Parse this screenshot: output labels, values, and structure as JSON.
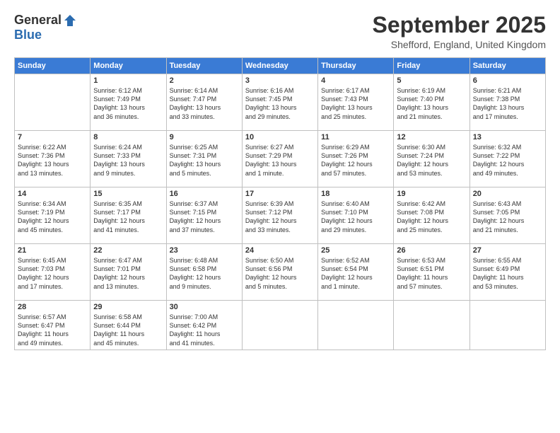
{
  "logo": {
    "general": "General",
    "blue": "Blue"
  },
  "title": "September 2025",
  "location": "Shefford, England, United Kingdom",
  "days_header": [
    "Sunday",
    "Monday",
    "Tuesday",
    "Wednesday",
    "Thursday",
    "Friday",
    "Saturday"
  ],
  "weeks": [
    [
      {
        "day": "",
        "info": ""
      },
      {
        "day": "1",
        "info": "Sunrise: 6:12 AM\nSunset: 7:49 PM\nDaylight: 13 hours\nand 36 minutes."
      },
      {
        "day": "2",
        "info": "Sunrise: 6:14 AM\nSunset: 7:47 PM\nDaylight: 13 hours\nand 33 minutes."
      },
      {
        "day": "3",
        "info": "Sunrise: 6:16 AM\nSunset: 7:45 PM\nDaylight: 13 hours\nand 29 minutes."
      },
      {
        "day": "4",
        "info": "Sunrise: 6:17 AM\nSunset: 7:43 PM\nDaylight: 13 hours\nand 25 minutes."
      },
      {
        "day": "5",
        "info": "Sunrise: 6:19 AM\nSunset: 7:40 PM\nDaylight: 13 hours\nand 21 minutes."
      },
      {
        "day": "6",
        "info": "Sunrise: 6:21 AM\nSunset: 7:38 PM\nDaylight: 13 hours\nand 17 minutes."
      }
    ],
    [
      {
        "day": "7",
        "info": "Sunrise: 6:22 AM\nSunset: 7:36 PM\nDaylight: 13 hours\nand 13 minutes."
      },
      {
        "day": "8",
        "info": "Sunrise: 6:24 AM\nSunset: 7:33 PM\nDaylight: 13 hours\nand 9 minutes."
      },
      {
        "day": "9",
        "info": "Sunrise: 6:25 AM\nSunset: 7:31 PM\nDaylight: 13 hours\nand 5 minutes."
      },
      {
        "day": "10",
        "info": "Sunrise: 6:27 AM\nSunset: 7:29 PM\nDaylight: 13 hours\nand 1 minute."
      },
      {
        "day": "11",
        "info": "Sunrise: 6:29 AM\nSunset: 7:26 PM\nDaylight: 12 hours\nand 57 minutes."
      },
      {
        "day": "12",
        "info": "Sunrise: 6:30 AM\nSunset: 7:24 PM\nDaylight: 12 hours\nand 53 minutes."
      },
      {
        "day": "13",
        "info": "Sunrise: 6:32 AM\nSunset: 7:22 PM\nDaylight: 12 hours\nand 49 minutes."
      }
    ],
    [
      {
        "day": "14",
        "info": "Sunrise: 6:34 AM\nSunset: 7:19 PM\nDaylight: 12 hours\nand 45 minutes."
      },
      {
        "day": "15",
        "info": "Sunrise: 6:35 AM\nSunset: 7:17 PM\nDaylight: 12 hours\nand 41 minutes."
      },
      {
        "day": "16",
        "info": "Sunrise: 6:37 AM\nSunset: 7:15 PM\nDaylight: 12 hours\nand 37 minutes."
      },
      {
        "day": "17",
        "info": "Sunrise: 6:39 AM\nSunset: 7:12 PM\nDaylight: 12 hours\nand 33 minutes."
      },
      {
        "day": "18",
        "info": "Sunrise: 6:40 AM\nSunset: 7:10 PM\nDaylight: 12 hours\nand 29 minutes."
      },
      {
        "day": "19",
        "info": "Sunrise: 6:42 AM\nSunset: 7:08 PM\nDaylight: 12 hours\nand 25 minutes."
      },
      {
        "day": "20",
        "info": "Sunrise: 6:43 AM\nSunset: 7:05 PM\nDaylight: 12 hours\nand 21 minutes."
      }
    ],
    [
      {
        "day": "21",
        "info": "Sunrise: 6:45 AM\nSunset: 7:03 PM\nDaylight: 12 hours\nand 17 minutes."
      },
      {
        "day": "22",
        "info": "Sunrise: 6:47 AM\nSunset: 7:01 PM\nDaylight: 12 hours\nand 13 minutes."
      },
      {
        "day": "23",
        "info": "Sunrise: 6:48 AM\nSunset: 6:58 PM\nDaylight: 12 hours\nand 9 minutes."
      },
      {
        "day": "24",
        "info": "Sunrise: 6:50 AM\nSunset: 6:56 PM\nDaylight: 12 hours\nand 5 minutes."
      },
      {
        "day": "25",
        "info": "Sunrise: 6:52 AM\nSunset: 6:54 PM\nDaylight: 12 hours\nand 1 minute."
      },
      {
        "day": "26",
        "info": "Sunrise: 6:53 AM\nSunset: 6:51 PM\nDaylight: 11 hours\nand 57 minutes."
      },
      {
        "day": "27",
        "info": "Sunrise: 6:55 AM\nSunset: 6:49 PM\nDaylight: 11 hours\nand 53 minutes."
      }
    ],
    [
      {
        "day": "28",
        "info": "Sunrise: 6:57 AM\nSunset: 6:47 PM\nDaylight: 11 hours\nand 49 minutes."
      },
      {
        "day": "29",
        "info": "Sunrise: 6:58 AM\nSunset: 6:44 PM\nDaylight: 11 hours\nand 45 minutes."
      },
      {
        "day": "30",
        "info": "Sunrise: 7:00 AM\nSunset: 6:42 PM\nDaylight: 11 hours\nand 41 minutes."
      },
      {
        "day": "",
        "info": ""
      },
      {
        "day": "",
        "info": ""
      },
      {
        "day": "",
        "info": ""
      },
      {
        "day": "",
        "info": ""
      }
    ]
  ]
}
